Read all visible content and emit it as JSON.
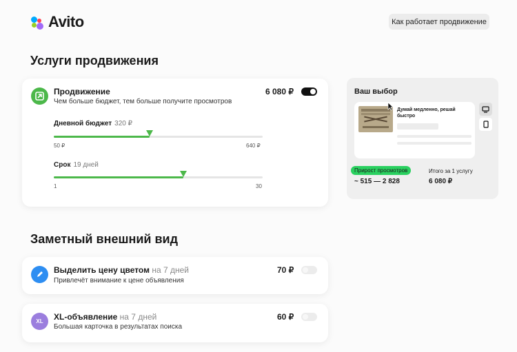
{
  "header": {
    "logo_text": "Avito",
    "how_button_label": "Как работает продвижение"
  },
  "promotion_section": {
    "title": "Услуги продвижения",
    "service": {
      "title": "Продвижение",
      "description": "Чем больше бюджет, тем больше получите просмотров",
      "price": "6 080 ₽",
      "enabled": true,
      "budget": {
        "label": "Дневной бюджет",
        "value_text": "320 ₽",
        "value": 320,
        "min_label": "50 ₽",
        "max_label": "640 ₽",
        "min": 50,
        "max": 640
      },
      "duration": {
        "label": "Срок",
        "value_text": "19 дней",
        "value": 19,
        "min_label": "1",
        "max_label": "30",
        "min": 1,
        "max": 30
      }
    }
  },
  "appearance_section": {
    "title": "Заметный внешний вид",
    "items": [
      {
        "title": "Выделить цену цветом",
        "period": "на 7 дней",
        "description": "Привлечёт внимание к цене объявления",
        "price": "70 ₽",
        "enabled": false,
        "icon": "pencil-icon",
        "icon_color": "#2e8ef2"
      },
      {
        "title": "XL-объявление",
        "period": "на 7 дней",
        "description": "Большая карточка в результатах поиска",
        "price": "60 ₽",
        "enabled": false,
        "icon": "xl-icon",
        "icon_text": "XL",
        "icon_color": "#9b7ede"
      }
    ]
  },
  "summary": {
    "title": "Ваш выбор",
    "preview_title": "Думай медленно, решай быстро",
    "views_badge": "Прирост просмотров",
    "views_value": "~ 515 — 2 828",
    "total_label": "Итого за 1 услугу",
    "total_value": "6 080 ₽"
  },
  "colors": {
    "accent_green": "#4cb84a",
    "badge_green": "#2ad160",
    "promo_icon_green": "#4cb84a"
  }
}
